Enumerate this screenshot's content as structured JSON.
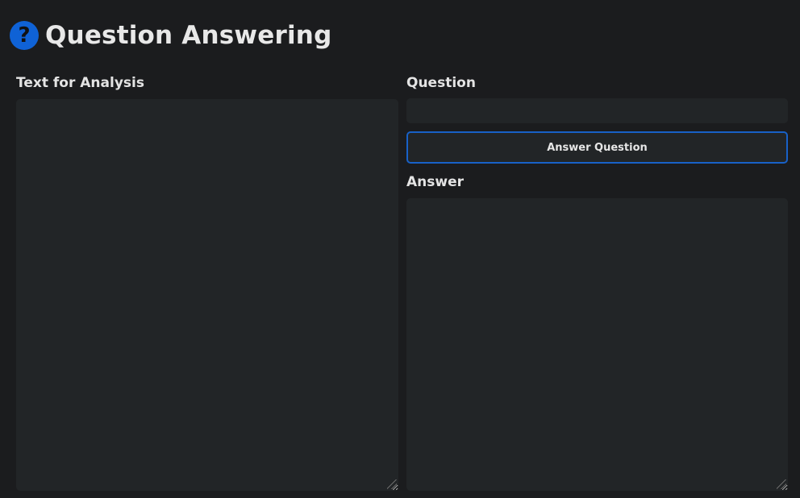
{
  "header": {
    "icon": "help-circle-icon",
    "icon_glyph": "?",
    "title": "Question Answering"
  },
  "analysis": {
    "label": "Text for Analysis",
    "value": ""
  },
  "question": {
    "label": "Question",
    "value": ""
  },
  "answer_button": {
    "label": "Answer Question"
  },
  "answer": {
    "label": "Answer",
    "value": ""
  },
  "colors": {
    "background": "#1b1c1e",
    "field": "#222527",
    "accent": "#0f62d6",
    "button_border": "#1861c7"
  }
}
